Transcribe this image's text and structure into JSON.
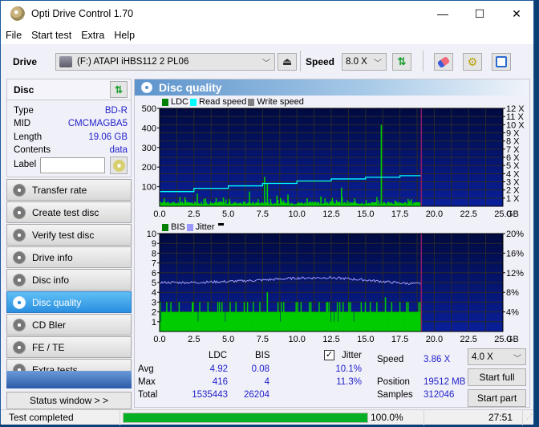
{
  "window": {
    "title": "Opti Drive Control 1.70",
    "controls": {
      "minimize": "—",
      "maximize": "☐",
      "close": "✕"
    }
  },
  "menu": [
    "File",
    "Start test",
    "Extra",
    "Help"
  ],
  "toolbar": {
    "drive_label": "Drive",
    "drive_value": "(F:)  ATAPI iHBS112  2 PL06",
    "speed_label": "Speed",
    "speed_value": "8.0 X",
    "icons": [
      "eject-icon",
      "refresh-icon",
      "eraser-icon",
      "settings-gears-icon",
      "save-icon"
    ]
  },
  "disc": {
    "header": "Disc",
    "fields": [
      {
        "key": "Type",
        "value": "BD-R"
      },
      {
        "key": "MID",
        "value": "CMCMAGBA5"
      },
      {
        "key": "Length",
        "value": "19.06 GB"
      },
      {
        "key": "Contents",
        "value": "data"
      }
    ],
    "label_key": "Label",
    "label_value": ""
  },
  "nav": [
    {
      "label": "Transfer rate",
      "active": false
    },
    {
      "label": "Create test disc",
      "active": false
    },
    {
      "label": "Verify test disc",
      "active": false
    },
    {
      "label": "Drive info",
      "active": false
    },
    {
      "label": "Disc info",
      "active": false
    },
    {
      "label": "Disc quality",
      "active": true
    },
    {
      "label": "CD Bler",
      "active": false
    },
    {
      "label": "FE / TE",
      "active": false
    },
    {
      "label": "Extra tests",
      "active": false
    }
  ],
  "status_window_label": "Status window > >",
  "main": {
    "title": "Disc quality"
  },
  "chart_data": [
    {
      "type": "bar",
      "title": "LDC",
      "legend": [
        {
          "name": "LDC",
          "color": "#008000"
        },
        {
          "name": "Read speed",
          "color": "#00ffff"
        },
        {
          "name": "Write speed",
          "color": "#808080"
        }
      ],
      "xlabel": "GB",
      "x_ticks": [
        "0.0",
        "2.5",
        "5.0",
        "7.5",
        "10.0",
        "12.5",
        "15.0",
        "17.5",
        "20.0",
        "22.5",
        "25.0"
      ],
      "xlim": [
        0,
        25
      ],
      "ylim": [
        0,
        500
      ],
      "y_ticks": [
        "100",
        "200",
        "300",
        "400",
        "500"
      ],
      "y2_ticks": [
        "1 X",
        "2 X",
        "3 X",
        "4 X",
        "5 X",
        "6 X",
        "7 X",
        "8 X",
        "9 X",
        "10 X",
        "11 X",
        "12 X"
      ],
      "y2lim": [
        0,
        12
      ],
      "disc_end_gb": 19.06,
      "ldc_baseline": 10,
      "ldc_spikes": [
        {
          "x": 0.3,
          "y": 40
        },
        {
          "x": 1.8,
          "y": 45
        },
        {
          "x": 2.7,
          "y": 65
        },
        {
          "x": 3.3,
          "y": 40
        },
        {
          "x": 4.6,
          "y": 45
        },
        {
          "x": 6.5,
          "y": 75
        },
        {
          "x": 7.6,
          "y": 150
        },
        {
          "x": 7.8,
          "y": 115
        },
        {
          "x": 8.5,
          "y": 55
        },
        {
          "x": 9.3,
          "y": 60
        },
        {
          "x": 10.7,
          "y": 40
        },
        {
          "x": 11.7,
          "y": 50
        },
        {
          "x": 13.2,
          "y": 95
        },
        {
          "x": 16.1,
          "y": 416
        },
        {
          "x": 17.1,
          "y": 30
        },
        {
          "x": 18.3,
          "y": 35
        }
      ],
      "read_speed": [
        {
          "x": 0,
          "y": 1.8
        },
        {
          "x": 2.5,
          "y": 2.2
        },
        {
          "x": 5.0,
          "y": 2.5
        },
        {
          "x": 7.5,
          "y": 2.8
        },
        {
          "x": 10.0,
          "y": 3.1
        },
        {
          "x": 12.5,
          "y": 3.35
        },
        {
          "x": 15.0,
          "y": 3.55
        },
        {
          "x": 17.5,
          "y": 3.75
        },
        {
          "x": 19.06,
          "y": 3.9
        }
      ]
    },
    {
      "type": "bar",
      "title": "BIS",
      "legend": [
        {
          "name": "BIS",
          "color": "#008000"
        },
        {
          "name": "Jitter",
          "color": "#9999ff"
        }
      ],
      "xlabel": "GB",
      "x_ticks": [
        "0.0",
        "2.5",
        "5.0",
        "7.5",
        "10.0",
        "12.5",
        "15.0",
        "17.5",
        "20.0",
        "22.5",
        "25.0"
      ],
      "xlim": [
        0,
        25
      ],
      "ylim": [
        0,
        10
      ],
      "y_ticks": [
        "1",
        "2",
        "3",
        "4",
        "5",
        "6",
        "7",
        "8",
        "9",
        "10"
      ],
      "y2_ticks": [
        "4%",
        "8%",
        "12%",
        "16%",
        "20%"
      ],
      "y2lim": [
        0,
        20
      ],
      "disc_end_gb": 19.06,
      "bis_baseline": 2,
      "bis_spikes": [
        {
          "x": 7.8,
          "y": 4
        },
        {
          "x": 16.4,
          "y": 3.5
        }
      ],
      "jitter": [
        {
          "x": 0,
          "y": 10.0
        },
        {
          "x": 2.5,
          "y": 10.0
        },
        {
          "x": 5.0,
          "y": 10.2
        },
        {
          "x": 7.5,
          "y": 10.5
        },
        {
          "x": 10.0,
          "y": 10.9
        },
        {
          "x": 12.5,
          "y": 11.0
        },
        {
          "x": 15.0,
          "y": 10.5
        },
        {
          "x": 17.5,
          "y": 9.9
        },
        {
          "x": 19.06,
          "y": 9.7
        }
      ]
    }
  ],
  "stats": {
    "col_ldc": "LDC",
    "col_bis": "BIS",
    "jitter_label": "Jitter",
    "jitter_checked": true,
    "rows": [
      {
        "label": "Avg",
        "ldc": "4.92",
        "bis": "0.08",
        "jitter": "10.1%"
      },
      {
        "label": "Max",
        "ldc": "416",
        "bis": "4",
        "jitter": "11.3%"
      },
      {
        "label": "Total",
        "ldc": "1535443",
        "bis": "26204",
        "jitter": ""
      }
    ],
    "speed_label": "Speed",
    "speed_value": "3.86 X",
    "position_label": "Position",
    "position_value": "19512 MB",
    "samples_label": "Samples",
    "samples_value": "312046",
    "test_speed": "4.0 X",
    "start_full": "Start full",
    "start_part": "Start part"
  },
  "statusbar": {
    "message": "Test completed",
    "progress_percent": 100,
    "progress_text": "100.0%",
    "elapsed": "27:51"
  },
  "colors": {
    "plot_bg_top": "#000a40",
    "plot_bg_bottom": "#0a1f9a",
    "ldc_green": "#00cc00",
    "read_speed": "#00ffff",
    "jitter": "#9999ff",
    "disc_end_marker": "#8b1a6a",
    "progress": "#06b025"
  }
}
